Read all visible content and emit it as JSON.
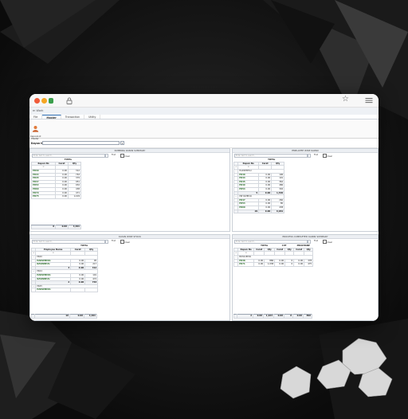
{
  "browser": {
    "more_icon": "hamburger-menu-icon"
  },
  "app": {
    "title": "m Work"
  },
  "tabs": [
    {
      "label": "File"
    },
    {
      "label": "Master"
    },
    {
      "label": "Transaction"
    },
    {
      "label": "Utility"
    }
  ],
  "ribbon": {
    "button_label_1": "Kapan/Lot",
    "button_label_2": "Master"
  },
  "kayan": {
    "label": "Kayan No :",
    "dropdown_glyph": "▾"
  },
  "common": {
    "search_placeholder": "Enter text to search...",
    "find_label": "Find",
    "clear_label": "Clear",
    "expand_glyph": "+",
    "filter_glyph": "≡"
  },
  "panels": {
    "nubbing": {
      "title": "NUBBING KAPAN SUMMARY",
      "header_group": "TOTAL",
      "col_kapan": "Kapan No",
      "col_carat": "Carat",
      "col_qty": "Qty",
      "rows": [
        {
          "kapan": "PR40",
          "carat": "0.00",
          "qty": "312"
        },
        {
          "kapan": "PR44",
          "carat": "0.00",
          "qty": "763"
        },
        {
          "kapan": "PR45",
          "carat": "0.00",
          "qty": "379"
        },
        {
          "kapan": "PR47",
          "carat": "0.00",
          "qty": "951"
        },
        {
          "kapan": "PR53",
          "carat": "0.00",
          "qty": "932"
        },
        {
          "kapan": "PR60",
          "carat": "0.00",
          "qty": "438"
        },
        {
          "kapan": "PR70",
          "carat": "0.00",
          "qty": "471"
        },
        {
          "kapan": "PR75",
          "carat": "0.00",
          "qty": "1,109"
        }
      ],
      "footer": {
        "count": "8",
        "carat": "0.00",
        "qty": "4,461"
      }
    },
    "employee": {
      "title": "EMPLOYEE WISE KAPAN",
      "header_group": "TOTAL",
      "col_kapan": "Kapan No",
      "col_carat": "Carat",
      "col_qty": "Qty",
      "groups": [
        {
          "name": "HARSHBHAI",
          "rows": [
            {
              "kapan": "PR40",
              "carat": "0.00",
              "qty": "196"
            },
            {
              "kapan": "PR44",
              "carat": "0.00",
              "qty": "191"
            },
            {
              "kapan": "PR45",
              "carat": "0.00",
              "qty": "362"
            },
            {
              "kapan": "PR49",
              "carat": "0.00",
              "qty": "486"
            },
            {
              "kapan": "PR54",
              "carat": "0.00",
              "qty": "302"
            }
          ],
          "subtotal": {
            "count": "5",
            "carat": "0.00",
            "qty": "1,536"
          }
        },
        {
          "name": "PRIYAMBHAI",
          "rows": [
            {
              "kapan": "PR47",
              "carat": "0.00",
              "qty": "260"
            },
            {
              "kapan": "PR53",
              "carat": "0.00",
              "qty": "80"
            },
            {
              "kapan": "PR60",
              "carat": "0.00",
              "qty": "438"
            }
          ]
        }
      ],
      "footer": {
        "count": "29",
        "carat": "0.00",
        "qty": "6,961"
      }
    },
    "kayan_stock": {
      "title": "KAYAN WISE STOCK",
      "header_group": "TOTAL",
      "col_emp": "Employee Name",
      "col_carat": "Carat",
      "col_qty": "Qty",
      "groups": [
        {
          "name": "PR40",
          "rows": [
            {
              "emp": "HARSHBHAI",
              "carat": "0.00",
              "qty": "95"
            },
            {
              "emp": "NAVINBHAI",
              "carat": "0.00",
              "qty": "217"
            }
          ],
          "subtotal": {
            "count": "3",
            "carat": "0.00",
            "qty": "312"
          }
        },
        {
          "name": "PR44",
          "rows": [
            {
              "emp": "HARSHBHAI",
              "carat": "0.00",
              "qty": "191"
            },
            {
              "emp": "NAVINBHAI",
              "carat": "0.00",
              "qty": "472"
            }
          ],
          "subtotal": {
            "count": "2",
            "carat": "0.00",
            "qty": "763"
          }
        },
        {
          "name": "PR45",
          "rows": [
            {
              "emp": "HARSHBHAI",
              "carat": "",
              "qty": ""
            }
          ]
        }
      ],
      "footer": {
        "count": "19",
        "carat": "0.00",
        "qty": "4,461"
      }
    },
    "process": {
      "title": "PROCESS COMPLETED KAPAN SUMMARY",
      "header_group_total": "TOTAL",
      "header_group_cut": "CUT",
      "header_group_prochane": "PROCHANE",
      "col_kapan": "Kapan No",
      "col_carat": "Carat",
      "col_qty": "Qty",
      "groups": [
        {
          "name": "BOSS1BHAI",
          "rows": [
            {
              "kapan": "PR38",
              "c1": "0.00",
              "q1": "886",
              "c2": "0.00",
              "q2": "0",
              "c3": "0.00",
              "q3": "378"
            },
            {
              "kapan": "PR71",
              "c1": "0.00",
              "q1": "1,038",
              "c2": "0.00",
              "q2": "0",
              "c3": "0.00",
              "q3": "475"
            }
          ]
        }
      ],
      "footer": {
        "count": "2",
        "c1": "0.00",
        "q1": "1,924",
        "c2": "0.00",
        "q2": "0",
        "c3": "0.00",
        "q3": "890"
      }
    }
  },
  "colors": {
    "accent_green": "#2c6e2c",
    "tab_accent": "#2f6fb3"
  }
}
